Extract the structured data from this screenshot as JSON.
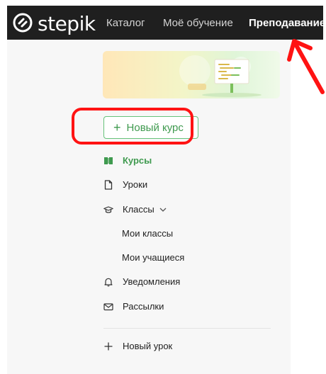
{
  "brand": {
    "logo_text": "stepik"
  },
  "nav": {
    "items": [
      {
        "label": "Каталог"
      },
      {
        "label": "Моё обучение"
      },
      {
        "label": "Преподавание"
      }
    ]
  },
  "sidebar": {
    "new_course_label": "Новый курс",
    "items": [
      {
        "label": "Курсы",
        "icon": "book-icon",
        "active": true
      },
      {
        "label": "Уроки",
        "icon": "document-icon"
      },
      {
        "label": "Классы",
        "icon": "graduation-cap-icon",
        "expanded": true
      },
      {
        "label": "Уведомления",
        "icon": "bell-icon"
      },
      {
        "label": "Рассылки",
        "icon": "mail-icon"
      }
    ],
    "classes_subitems": [
      {
        "label": "Мои классы"
      },
      {
        "label": "Мои учащиеся"
      }
    ],
    "new_lesson_label": "Новый урок"
  },
  "colors": {
    "accent_green": "#3f9a4f",
    "topbar_bg": "#1f1f1f",
    "annotation_red": "#ff1313"
  }
}
